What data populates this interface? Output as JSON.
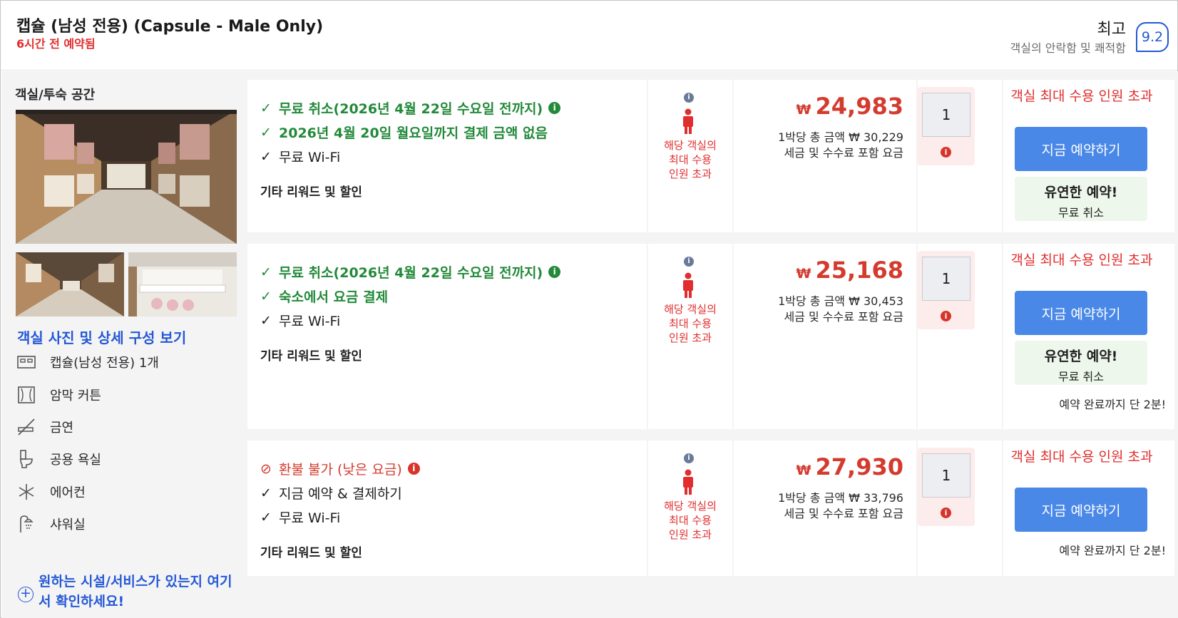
{
  "header": {
    "room_title": "캡슐 (남성 전용) (Capsule - Male Only)",
    "booked_ago": "6시간 전 예약됨",
    "rating_word": "최고",
    "rating_sub": "객실의 안락함 및 쾌적함",
    "score": "9.2"
  },
  "left": {
    "title": "객실/투숙 공간",
    "photo_link": "객실 사진 및 상세 구성 보기",
    "amenities": [
      {
        "label": "캡슐(남성 전용) 1개",
        "icon": "bed-icon"
      },
      {
        "label": "암막 커튼",
        "icon": "curtain-icon"
      },
      {
        "label": "금연",
        "icon": "no-smoking-icon"
      },
      {
        "label": "공용 욕실",
        "icon": "toilet-icon"
      },
      {
        "label": "에어컨",
        "icon": "snowflake-icon"
      },
      {
        "label": "샤워실",
        "icon": "shower-icon"
      }
    ],
    "more_icon": "+",
    "more_link": "원하는 시설/서비스가 있는지 여기서 확인하세요!"
  },
  "rows": [
    {
      "features": [
        {
          "mark": "✓",
          "text": "무료 취소(2026년 4월 22일 수요일 전까지)",
          "style": "green",
          "info": "i"
        },
        {
          "mark": "✓",
          "text": "2026년 4월 20일 월요일까지 결제 금액 없음",
          "style": "green"
        },
        {
          "mark": "✓",
          "text": "무료 Wi-Fi",
          "style": "dark"
        }
      ],
      "rewards": "기타 리워드 및 할인",
      "occ_info": "i",
      "occ_text": "해당 객실의 최대 수용 인원 초과",
      "currency": "₩",
      "price": "24,983",
      "total": "1박당 총 금액 ₩ 30,229",
      "tax": "세금 및 수수료 포함 요금",
      "qty": "1",
      "qty_warn": "i",
      "exceed": "객실 최대 수용 인원 초과",
      "book": "지금 예약하기",
      "flex_title": "유연한 예약!",
      "flex_sub": "무료 취소",
      "only2": ""
    },
    {
      "features": [
        {
          "mark": "✓",
          "text": "무료 취소(2026년 4월 22일 수요일 전까지)",
          "style": "green",
          "info": "i"
        },
        {
          "mark": "✓",
          "text": "숙소에서 요금 결제",
          "style": "green"
        },
        {
          "mark": "✓",
          "text": "무료 Wi-Fi",
          "style": "dark"
        }
      ],
      "rewards": "기타 리워드 및 할인",
      "occ_info": "i",
      "occ_text": "해당 객실의 최대 수용 인원 초과",
      "currency": "₩",
      "price": "25,168",
      "total": "1박당 총 금액 ₩ 30,453",
      "tax": "세금 및 수수료 포함 요금",
      "qty": "1",
      "qty_warn": "i",
      "exceed": "객실 최대 수용 인원 초과",
      "book": "지금 예약하기",
      "flex_title": "유연한 예약!",
      "flex_sub": "무료 취소",
      "only2": "예약 완료까지 단 2분!"
    },
    {
      "features": [
        {
          "mark": "⊘",
          "text": "환불 불가 (낮은 요금)",
          "style": "redf",
          "info": "i"
        },
        {
          "mark": "✓",
          "text": "지금 예약 & 결제하기",
          "style": "dark"
        },
        {
          "mark": "✓",
          "text": "무료 Wi-Fi",
          "style": "dark"
        }
      ],
      "rewards": "기타 리워드 및 할인",
      "occ_info": "i",
      "occ_text": "해당 객실의 최대 수용 인원 초과",
      "currency": "₩",
      "price": "27,930",
      "total": "1박당 총 금액 ₩ 33,796",
      "tax": "세금 및 수수료 포함 요금",
      "qty": "1",
      "qty_warn": "i",
      "exceed": "객실 최대 수용 인원 초과",
      "book": "지금 예약하기",
      "flex_title": "",
      "flex_sub": "",
      "only2": "예약 완료까지 단 2분!"
    }
  ]
}
